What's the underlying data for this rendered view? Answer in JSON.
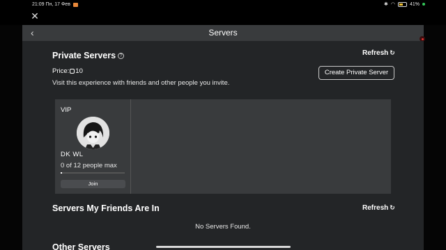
{
  "status_bar": {
    "time_date": "21:09  Пн, 17 Фев",
    "battery": "41%"
  },
  "header": {
    "title": "Servers"
  },
  "private_servers": {
    "title": "Private Servers",
    "refresh_label": "Refresh",
    "price_label": "Price:",
    "price_value": "10",
    "description": "Visit this experience with friends and other people you invite.",
    "create_button": "Create Private Server",
    "card": {
      "tag": "VIP",
      "owner": "DK  WL",
      "occupancy": "0 of 12 people max",
      "fill_fraction": 0.0,
      "join_label": "Join"
    }
  },
  "friends_servers": {
    "title": "Servers My Friends Are In",
    "refresh_label": "Refresh",
    "empty_text": "No Servers Found."
  },
  "other_servers": {
    "title": "Other Servers"
  },
  "icons": [
    "close-icon",
    "back-icon",
    "help-icon",
    "refresh-icon",
    "robux-icon",
    "wifi-icon",
    "battery-icon"
  ]
}
